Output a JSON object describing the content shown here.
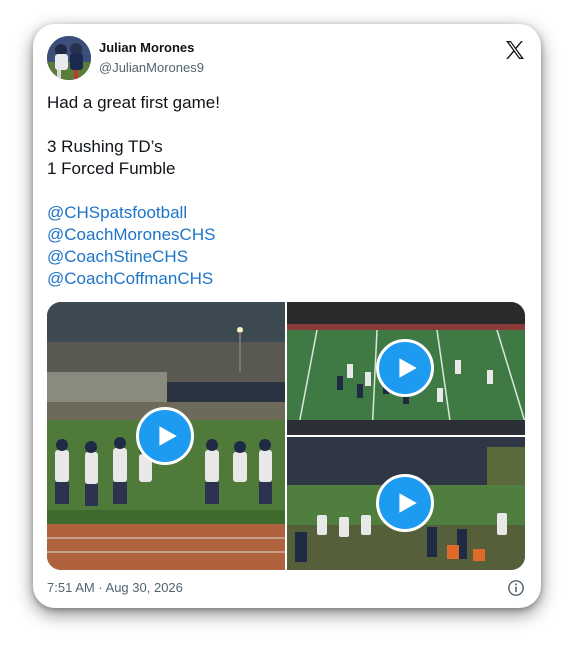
{
  "author": {
    "display_name": "Julian Morones",
    "handle": "@JulianMorones9",
    "avatar_icon": "player-photo-avatar"
  },
  "platform_icon": "x-logo-icon",
  "tweet": {
    "lines": [
      "Had a great first game!",
      "",
      "3 Rushing TD’s",
      "1 Forced Fumble",
      ""
    ],
    "mentions": [
      "@CHSpatsfootball",
      "@CoachMoronesCHS",
      "@CoachStineCHS",
      "@CoachCoffmanCHS"
    ]
  },
  "media": {
    "videos": [
      {
        "name": "video-1",
        "icon": "play-icon"
      },
      {
        "name": "video-2",
        "icon": "play-icon"
      },
      {
        "name": "video-3",
        "icon": "play-icon"
      }
    ]
  },
  "footer": {
    "timestamp": "7:51 AM · Aug 30, 2026",
    "info_icon": "info-icon"
  },
  "colors": {
    "mention": "#1d74c8",
    "play_button": "#1d9bf0",
    "text": "#0f1419",
    "secondary_text": "#536471"
  }
}
